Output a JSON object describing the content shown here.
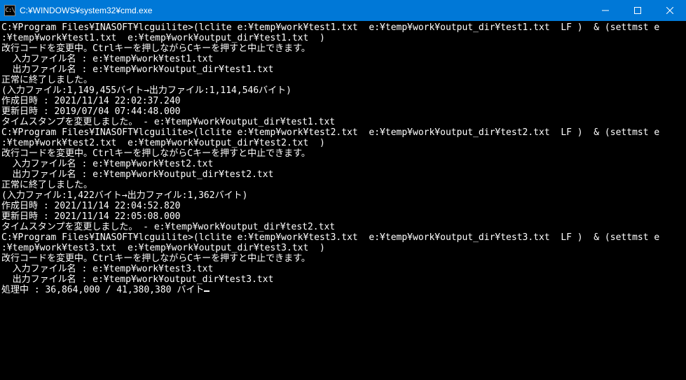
{
  "window": {
    "icon_label": "C:\\",
    "title": "C:¥WINDOWS¥system32¥cmd.exe"
  },
  "controls": {
    "minimize_label": "Minimize",
    "maximize_label": "Maximize",
    "close_label": "Close"
  },
  "console_lines": [
    "",
    "C:¥Program Files¥INASOFT¥lcguilite>(lclite e:¥temp¥work¥test1.txt  e:¥temp¥work¥output_dir¥test1.txt  LF )  & (settmst e",
    ":¥temp¥work¥test1.txt  e:¥temp¥work¥output_dir¥test1.txt  )",
    "改行コードを変更中。Ctrlキーを押しながらCキーを押すと中止できます。",
    "  入力ファイル名 : e:¥temp¥work¥test1.txt",
    "  出力ファイル名 : e:¥temp¥work¥output_dir¥test1.txt",
    "",
    "正常に終了しました。",
    "(入力ファイル:1,149,455バイト→出力ファイル:1,114,546バイト)",
    "作成日時 : 2021/11/14 22:02:37.240",
    "更新日時 : 2019/07/04 07:44:48.000",
    "タイムスタンプを変更しました。 - e:¥temp¥work¥output_dir¥test1.txt",
    "",
    "C:¥Program Files¥INASOFT¥lcguilite>(lclite e:¥temp¥work¥test2.txt  e:¥temp¥work¥output_dir¥test2.txt  LF )  & (settmst e",
    ":¥temp¥work¥test2.txt  e:¥temp¥work¥output_dir¥test2.txt  )",
    "改行コードを変更中。Ctrlキーを押しながらCキーを押すと中止できます。",
    "  入力ファイル名 : e:¥temp¥work¥test2.txt",
    "  出力ファイル名 : e:¥temp¥work¥output_dir¥test2.txt",
    "",
    "正常に終了しました。",
    "(入力ファイル:1,422バイト→出力ファイル:1,362バイト)",
    "作成日時 : 2021/11/14 22:04:52.820",
    "更新日時 : 2021/11/14 22:05:08.000",
    "タイムスタンプを変更しました。 - e:¥temp¥work¥output_dir¥test2.txt",
    "",
    "C:¥Program Files¥INASOFT¥lcguilite>(lclite e:¥temp¥work¥test3.txt  e:¥temp¥work¥output_dir¥test3.txt  LF )  & (settmst e",
    ":¥temp¥work¥test3.txt  e:¥temp¥work¥output_dir¥test3.txt  )",
    "改行コードを変更中。Ctrlキーを押しながらCキーを押すと中止できます。",
    "  入力ファイル名 : e:¥temp¥work¥test3.txt",
    "  出力ファイル名 : e:¥temp¥work¥output_dir¥test3.txt",
    "",
    "処理中 : 36,864,000 / 41,380,380 バイト"
  ]
}
